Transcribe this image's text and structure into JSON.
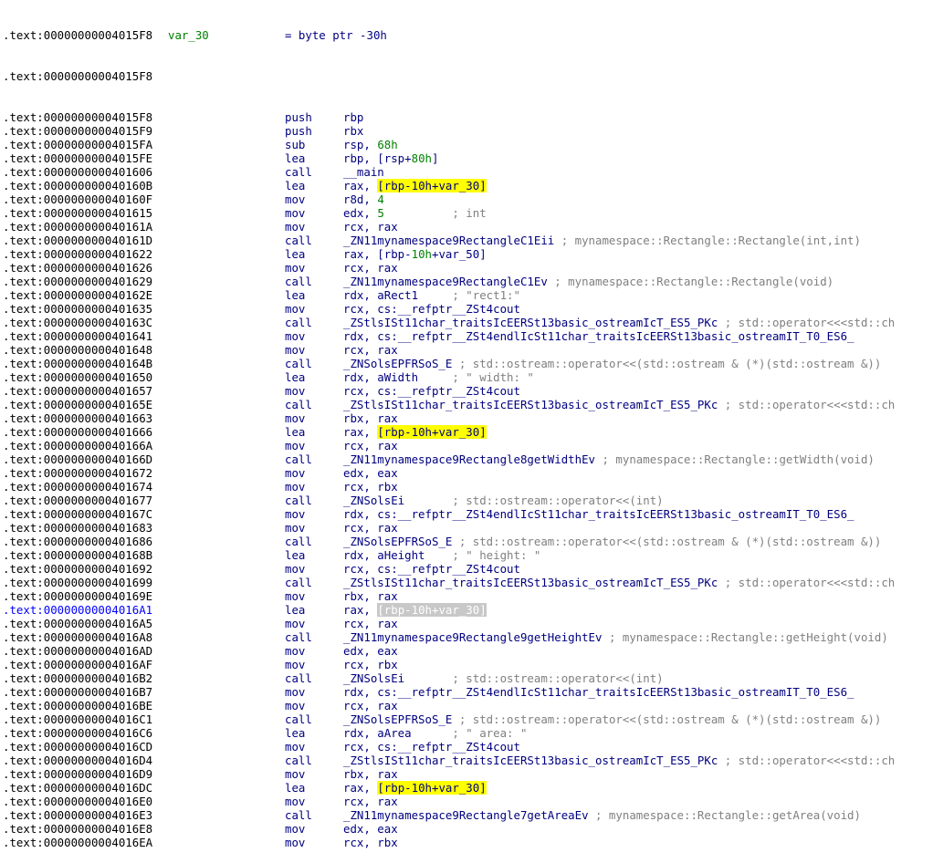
{
  "colors": {
    "background": "#ffffff",
    "address": "#000000",
    "current_address": "#0000ff",
    "mnemonic": "#000080",
    "number": "#008000",
    "comment": "#808080",
    "highlight": "#ffff00",
    "highlight_dim": "#c8c8c8"
  },
  "header": {
    "addr1": ".text:00000000004015F8",
    "label": "var_30",
    "definition": "= byte ptr -30h",
    "addr2": ".text:00000000004015F8"
  },
  "rows": [
    {
      "addr": ".text:00000000004015F8",
      "mn": "push",
      "op": "rbp",
      "num": "",
      "tail": "",
      "cmt": "",
      "hl": ""
    },
    {
      "addr": ".text:00000000004015F9",
      "mn": "push",
      "op": "rbx",
      "num": "",
      "tail": "",
      "cmt": "",
      "hl": ""
    },
    {
      "addr": ".text:00000000004015FA",
      "mn": "sub",
      "op": "rsp, ",
      "num": "68h",
      "tail": "",
      "cmt": "",
      "hl": ""
    },
    {
      "addr": ".text:00000000004015FE",
      "mn": "lea",
      "op": "rbp, [rsp+",
      "num": "80h",
      "tail": "]",
      "cmt": "",
      "hl": ""
    },
    {
      "addr": ".text:0000000000401606",
      "mn": "call",
      "op": "__main",
      "num": "",
      "tail": "",
      "cmt": "",
      "hl": ""
    },
    {
      "addr": ".text:000000000040160B",
      "mn": "lea",
      "op": "rax, ",
      "num": "",
      "tail": "",
      "cmt": "",
      "hl": "[rbp-10h+var_30]"
    },
    {
      "addr": ".text:000000000040160F",
      "mn": "mov",
      "op": "r8d, ",
      "num": "4",
      "tail": "",
      "cmt": "",
      "hl": ""
    },
    {
      "addr": ".text:0000000000401615",
      "mn": "mov",
      "op": "edx, ",
      "num": "5",
      "tail": "          ",
      "cmt": "; int",
      "hl": ""
    },
    {
      "addr": ".text:000000000040161A",
      "mn": "mov",
      "op": "rcx, rax",
      "num": "",
      "tail": "",
      "cmt": "",
      "hl": ""
    },
    {
      "addr": ".text:000000000040161D",
      "mn": "call",
      "op": "_ZN11mynamespace9RectangleC1Eii ",
      "num": "",
      "tail": "",
      "cmt": "; mynamespace::Rectangle::Rectangle(int,int)",
      "hl": ""
    },
    {
      "addr": ".text:0000000000401622",
      "mn": "lea",
      "op": "rax, [rbp-",
      "num": "10h",
      "tail": "+var_50]",
      "cmt": "",
      "hl": ""
    },
    {
      "addr": ".text:0000000000401626",
      "mn": "mov",
      "op": "rcx, rax",
      "num": "",
      "tail": "",
      "cmt": "",
      "hl": ""
    },
    {
      "addr": ".text:0000000000401629",
      "mn": "call",
      "op": "_ZN11mynamespace9RectangleC1Ev ",
      "num": "",
      "tail": "",
      "cmt": "; mynamespace::Rectangle::Rectangle(void)",
      "hl": ""
    },
    {
      "addr": ".text:000000000040162E",
      "mn": "lea",
      "op": "rdx, aRect1     ",
      "num": "",
      "tail": "",
      "cmt": "; \"rect1:\"",
      "hl": ""
    },
    {
      "addr": ".text:0000000000401635",
      "mn": "mov",
      "op": "rcx, cs:__refptr__ZSt4cout",
      "num": "",
      "tail": "",
      "cmt": "",
      "hl": ""
    },
    {
      "addr": ".text:000000000040163C",
      "mn": "call",
      "op": "_ZStlsISt11char_traitsIcEERSt13basic_ostreamIcT_ES5_PKc ",
      "num": "",
      "tail": "",
      "cmt": "; std::operator<<<std::ch",
      "hl": ""
    },
    {
      "addr": ".text:0000000000401641",
      "mn": "mov",
      "op": "rdx, cs:__refptr__ZSt4endlIcSt11char_traitsIcEERSt13basic_ostreamIT_T0_ES6_",
      "num": "",
      "tail": "",
      "cmt": "",
      "hl": ""
    },
    {
      "addr": ".text:0000000000401648",
      "mn": "mov",
      "op": "rcx, rax",
      "num": "",
      "tail": "",
      "cmt": "",
      "hl": ""
    },
    {
      "addr": ".text:000000000040164B",
      "mn": "call",
      "op": "_ZNSolsEPFRSoS_E ",
      "num": "",
      "tail": "",
      "cmt": "; std::ostream::operator<<(std::ostream & (*)(std::ostream &))",
      "hl": ""
    },
    {
      "addr": ".text:0000000000401650",
      "mn": "lea",
      "op": "rdx, aWidth     ",
      "num": "",
      "tail": "",
      "cmt": "; \" width: \"",
      "hl": ""
    },
    {
      "addr": ".text:0000000000401657",
      "mn": "mov",
      "op": "rcx, cs:__refptr__ZSt4cout",
      "num": "",
      "tail": "",
      "cmt": "",
      "hl": ""
    },
    {
      "addr": ".text:000000000040165E",
      "mn": "call",
      "op": "_ZStlsISt11char_traitsIcEERSt13basic_ostreamIcT_ES5_PKc ",
      "num": "",
      "tail": "",
      "cmt": "; std::operator<<<std::ch",
      "hl": ""
    },
    {
      "addr": ".text:0000000000401663",
      "mn": "mov",
      "op": "rbx, rax",
      "num": "",
      "tail": "",
      "cmt": "",
      "hl": ""
    },
    {
      "addr": ".text:0000000000401666",
      "mn": "lea",
      "op": "rax, ",
      "num": "",
      "tail": "",
      "cmt": "",
      "hl": "[rbp-10h+var_30]"
    },
    {
      "addr": ".text:000000000040166A",
      "mn": "mov",
      "op": "rcx, rax",
      "num": "",
      "tail": "",
      "cmt": "",
      "hl": ""
    },
    {
      "addr": ".text:000000000040166D",
      "mn": "call",
      "op": "_ZN11mynamespace9Rectangle8getWidthEv ",
      "num": "",
      "tail": "",
      "cmt": "; mynamespace::Rectangle::getWidth(void)",
      "hl": ""
    },
    {
      "addr": ".text:0000000000401672",
      "mn": "mov",
      "op": "edx, eax",
      "num": "",
      "tail": "",
      "cmt": "",
      "hl": ""
    },
    {
      "addr": ".text:0000000000401674",
      "mn": "mov",
      "op": "rcx, rbx",
      "num": "",
      "tail": "",
      "cmt": "",
      "hl": ""
    },
    {
      "addr": ".text:0000000000401677",
      "mn": "call",
      "op": "_ZNSolsEi       ",
      "num": "",
      "tail": "",
      "cmt": "; std::ostream::operator<<(int)",
      "hl": ""
    },
    {
      "addr": ".text:000000000040167C",
      "mn": "mov",
      "op": "rdx, cs:__refptr__ZSt4endlIcSt11char_traitsIcEERSt13basic_ostreamIT_T0_ES6_",
      "num": "",
      "tail": "",
      "cmt": "",
      "hl": ""
    },
    {
      "addr": ".text:0000000000401683",
      "mn": "mov",
      "op": "rcx, rax",
      "num": "",
      "tail": "",
      "cmt": "",
      "hl": ""
    },
    {
      "addr": ".text:0000000000401686",
      "mn": "call",
      "op": "_ZNSolsEPFRSoS_E ",
      "num": "",
      "tail": "",
      "cmt": "; std::ostream::operator<<(std::ostream & (*)(std::ostream &))",
      "hl": ""
    },
    {
      "addr": ".text:000000000040168B",
      "mn": "lea",
      "op": "rdx, aHeight    ",
      "num": "",
      "tail": "",
      "cmt": "; \" height: \"",
      "hl": ""
    },
    {
      "addr": ".text:0000000000401692",
      "mn": "mov",
      "op": "rcx, cs:__refptr__ZSt4cout",
      "num": "",
      "tail": "",
      "cmt": "",
      "hl": ""
    },
    {
      "addr": ".text:0000000000401699",
      "mn": "call",
      "op": "_ZStlsISt11char_traitsIcEERSt13basic_ostreamIcT_ES5_PKc ",
      "num": "",
      "tail": "",
      "cmt": "; std::operator<<<std::ch",
      "hl": ""
    },
    {
      "addr": ".text:000000000040169E",
      "mn": "mov",
      "op": "rbx, rax",
      "num": "",
      "tail": "",
      "cmt": "",
      "hl": ""
    },
    {
      "addr": ".text:00000000004016A1",
      "mn": "lea",
      "op": "rax, ",
      "num": "",
      "tail": "",
      "cmt": "",
      "hl": "[rbp-10h+var_30]",
      "current": true
    },
    {
      "addr": ".text:00000000004016A5",
      "mn": "mov",
      "op": "rcx, rax",
      "num": "",
      "tail": "",
      "cmt": "",
      "hl": ""
    },
    {
      "addr": ".text:00000000004016A8",
      "mn": "call",
      "op": "_ZN11mynamespace9Rectangle9getHeightEv ",
      "num": "",
      "tail": "",
      "cmt": "; mynamespace::Rectangle::getHeight(void)",
      "hl": ""
    },
    {
      "addr": ".text:00000000004016AD",
      "mn": "mov",
      "op": "edx, eax",
      "num": "",
      "tail": "",
      "cmt": "",
      "hl": ""
    },
    {
      "addr": ".text:00000000004016AF",
      "mn": "mov",
      "op": "rcx, rbx",
      "num": "",
      "tail": "",
      "cmt": "",
      "hl": ""
    },
    {
      "addr": ".text:00000000004016B2",
      "mn": "call",
      "op": "_ZNSolsEi       ",
      "num": "",
      "tail": "",
      "cmt": "; std::ostream::operator<<(int)",
      "hl": ""
    },
    {
      "addr": ".text:00000000004016B7",
      "mn": "mov",
      "op": "rdx, cs:__refptr__ZSt4endlIcSt11char_traitsIcEERSt13basic_ostreamIT_T0_ES6_",
      "num": "",
      "tail": "",
      "cmt": "",
      "hl": ""
    },
    {
      "addr": ".text:00000000004016BE",
      "mn": "mov",
      "op": "rcx, rax",
      "num": "",
      "tail": "",
      "cmt": "",
      "hl": ""
    },
    {
      "addr": ".text:00000000004016C1",
      "mn": "call",
      "op": "_ZNSolsEPFRSoS_E ",
      "num": "",
      "tail": "",
      "cmt": "; std::ostream::operator<<(std::ostream & (*)(std::ostream &))",
      "hl": ""
    },
    {
      "addr": ".text:00000000004016C6",
      "mn": "lea",
      "op": "rdx, aArea      ",
      "num": "",
      "tail": "",
      "cmt": "; \" area: \"",
      "hl": ""
    },
    {
      "addr": ".text:00000000004016CD",
      "mn": "mov",
      "op": "rcx, cs:__refptr__ZSt4cout",
      "num": "",
      "tail": "",
      "cmt": "",
      "hl": ""
    },
    {
      "addr": ".text:00000000004016D4",
      "mn": "call",
      "op": "_ZStlsISt11char_traitsIcEERSt13basic_ostreamIcT_ES5_PKc ",
      "num": "",
      "tail": "",
      "cmt": "; std::operator<<<std::ch",
      "hl": ""
    },
    {
      "addr": ".text:00000000004016D9",
      "mn": "mov",
      "op": "rbx, rax",
      "num": "",
      "tail": "",
      "cmt": "",
      "hl": ""
    },
    {
      "addr": ".text:00000000004016DC",
      "mn": "lea",
      "op": "rax, ",
      "num": "",
      "tail": "",
      "cmt": "",
      "hl": "[rbp-10h+var_30]"
    },
    {
      "addr": ".text:00000000004016E0",
      "mn": "mov",
      "op": "rcx, rax",
      "num": "",
      "tail": "",
      "cmt": "",
      "hl": ""
    },
    {
      "addr": ".text:00000000004016E3",
      "mn": "call",
      "op": "_ZN11mynamespace9Rectangle7getAreaEv ",
      "num": "",
      "tail": "",
      "cmt": "; mynamespace::Rectangle::getArea(void)",
      "hl": ""
    },
    {
      "addr": ".text:00000000004016E8",
      "mn": "mov",
      "op": "edx, eax",
      "num": "",
      "tail": "",
      "cmt": "",
      "hl": ""
    },
    {
      "addr": ".text:00000000004016EA",
      "mn": "mov",
      "op": "rcx, rbx",
      "num": "",
      "tail": "",
      "cmt": "",
      "hl": ""
    }
  ]
}
